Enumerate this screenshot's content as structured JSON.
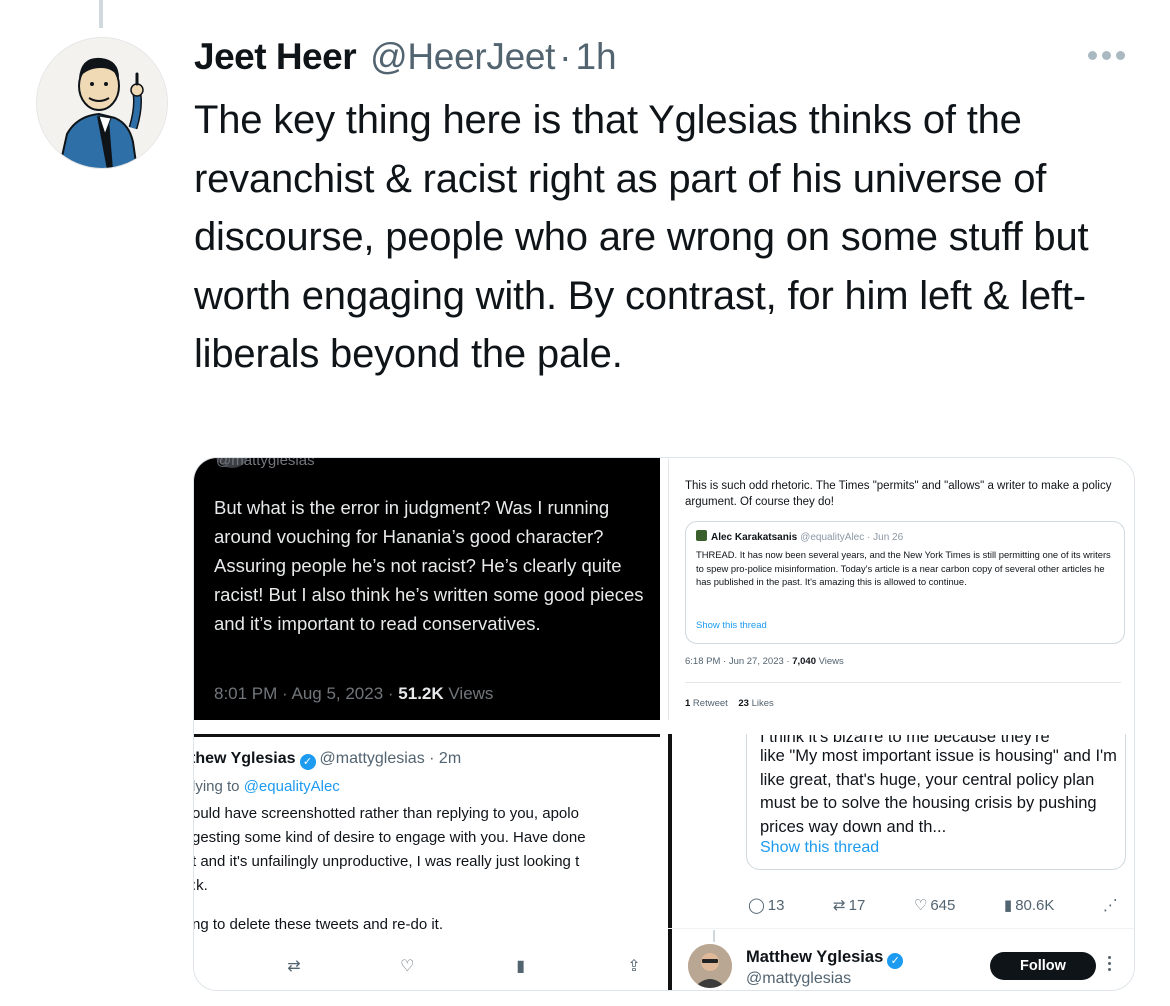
{
  "tweet": {
    "author_name": "Jeet Heer",
    "author_handle": "@HeerJeet",
    "separator": "·",
    "time": "1h",
    "text": "The key thing here is that Yglesias thinks of the revanchist & racist right as part of his universe of discourse, people who are wrong on some stuff but worth engaging with. By contrast, for him left & left-liberals beyond the pale."
  },
  "media": {
    "top_left": {
      "cut_handle": "@mattyglesias",
      "text": "But what is the error in judgment? Was I running around vouching for Hanania’s good character? Assuring people he’s not racist? He’s clearly quite racist! But I also think he’s written some good pieces and it’s important to read conservatives.",
      "time": "8:01 PM · Aug 5, 2023 · ",
      "views_count": "51.2K",
      "views_label": " Views"
    },
    "top_right": {
      "text": "This is such odd rhetoric. The Times \"permits\" and \"allows\" a writer to make a policy argument. Of course they do!",
      "quote_name": "Alec Karakatsanis",
      "quote_meta": "@equalityAlec · Jun 26",
      "quote_text": "THREAD. It has now been several years, and the New York Times is still permitting one of its writers to spew pro-police misinformation. Today's article is a near carbon copy of several other articles he has published in the past. It's amazing this is allowed to continue.",
      "quote_link": "Show this thread",
      "time": "6:18 PM · Jun 27, 2023 · ",
      "views_count": "7,040",
      "views_label": " Views",
      "retweets_count": "1",
      "retweets_label": " Retweet",
      "likes_count": "23",
      "likes_label": " Likes"
    },
    "bottom_left": {
      "name": "thew Yglesias",
      "handle": "@mattyglesias · 2m",
      "reply_prefix": "lying to ",
      "reply_to": "@equalityAlec",
      "text": "ould have screenshotted rather than replying to you, apolo\ngesting some kind of desire to engage with you. Have done\nt and it's unfailingly unproductive, I was really just looking t\n:k.",
      "text2": "ng to delete these tweets and re-do it."
    },
    "bottom_right": {
      "cut_line": "I think it's bizarre to me because they're",
      "quote_text": "like \"My most important issue is housing\" and I'm like great, that's huge, your central policy plan must be to solve the housing crisis by pushing prices way down and th...",
      "quote_link": "Show this thread",
      "replies": "13",
      "retweets": "17",
      "likes": "645",
      "views": "80.6K",
      "author_name": "Matthew Yglesias",
      "author_handle": "@mattyglesias",
      "follow_label": "Follow"
    }
  },
  "colors": {
    "accent": "#1d9bf0",
    "text": "#0f1419",
    "muted": "#536471"
  }
}
